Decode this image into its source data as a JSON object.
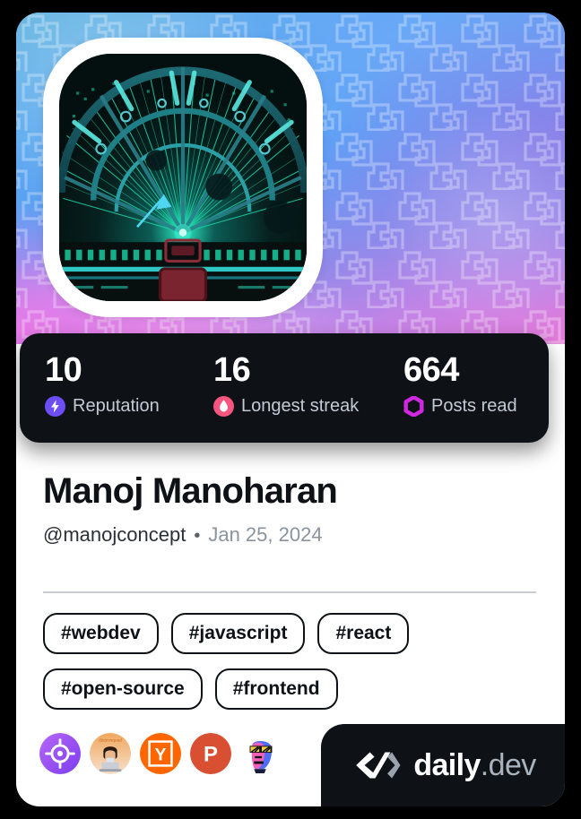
{
  "card": {
    "type": "devcard",
    "background_color": "#000000",
    "card_color": "#ffffff"
  },
  "cover": {
    "gradient_colors": [
      "#5fb3e0",
      "#59a8ef",
      "#5e9df5",
      "#8f8aea",
      "#c483e6",
      "#e57ad9"
    ],
    "watermark": "daily-dev-chevron-pattern"
  },
  "avatar": {
    "alt": "sci-fi control room dome with radiating teal data lines",
    "frame_color": "#ffffff"
  },
  "stats": {
    "background_color": "#0e1217",
    "items": [
      {
        "value": "10",
        "label": "Reputation",
        "icon": "bolt-icon",
        "icon_color": "#6d4df6"
      },
      {
        "value": "16",
        "label": "Longest streak",
        "icon": "flame-icon",
        "icon_color": "#f5557f"
      },
      {
        "value": "664",
        "label": "Posts read",
        "icon": "ring-icon",
        "icon_color": "#cf28e0"
      }
    ]
  },
  "identity": {
    "full_name": "Manoj Manoharan",
    "handle": "@manojconcept",
    "separator": "•",
    "joined": "Jan 25, 2024"
  },
  "tags": [
    "#webdev",
    "#javascript",
    "#react",
    "#open-source",
    "#frontend"
  ],
  "badges": [
    {
      "name": "target-badge",
      "color": "#a855f7"
    },
    {
      "name": "avatar-badge",
      "color": "#e8a96a"
    },
    {
      "name": "hackernews-badge",
      "color": "#ff6600",
      "letter": "Y"
    },
    {
      "name": "producthunt-badge",
      "color": "#d94f32",
      "letter": "P"
    },
    {
      "name": "pixel-face-badge",
      "color": "#4f6df5"
    }
  ],
  "brand": {
    "name_primary": "daily",
    "name_secondary": ".dev",
    "background_color": "#0e1217",
    "mark": "daily-dev-logo-icon"
  }
}
